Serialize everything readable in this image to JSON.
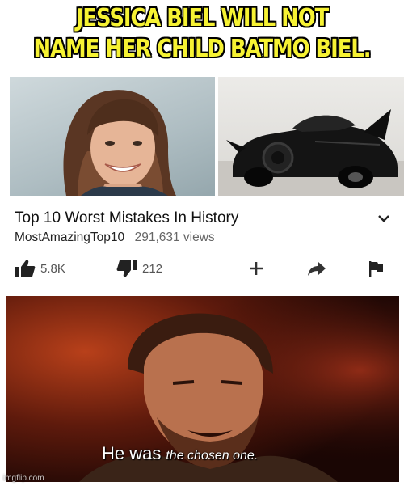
{
  "meme": {
    "caption_line1": "JESSICA BIEL WILL NOT",
    "caption_line2": "NAME HER CHILD BATMO BIEL.",
    "caption_color": "#f6f233"
  },
  "video": {
    "title": "Top 10 Worst Mistakes In History",
    "channel": "MostAmazingTop10",
    "views": "291,631 views",
    "expand_icon": "chevron-down-icon",
    "likes": "5.8K",
    "dislikes": "212",
    "like_icon": "thumbs-up-icon",
    "dislike_icon": "thumbs-down-icon",
    "add_icon": "plus-icon",
    "share_icon": "share-arrow-icon",
    "flag_icon": "flag-icon"
  },
  "still": {
    "subtitle_big": "He was",
    "subtitle_small": "the chosen one."
  },
  "watermark": "imgflip.com"
}
